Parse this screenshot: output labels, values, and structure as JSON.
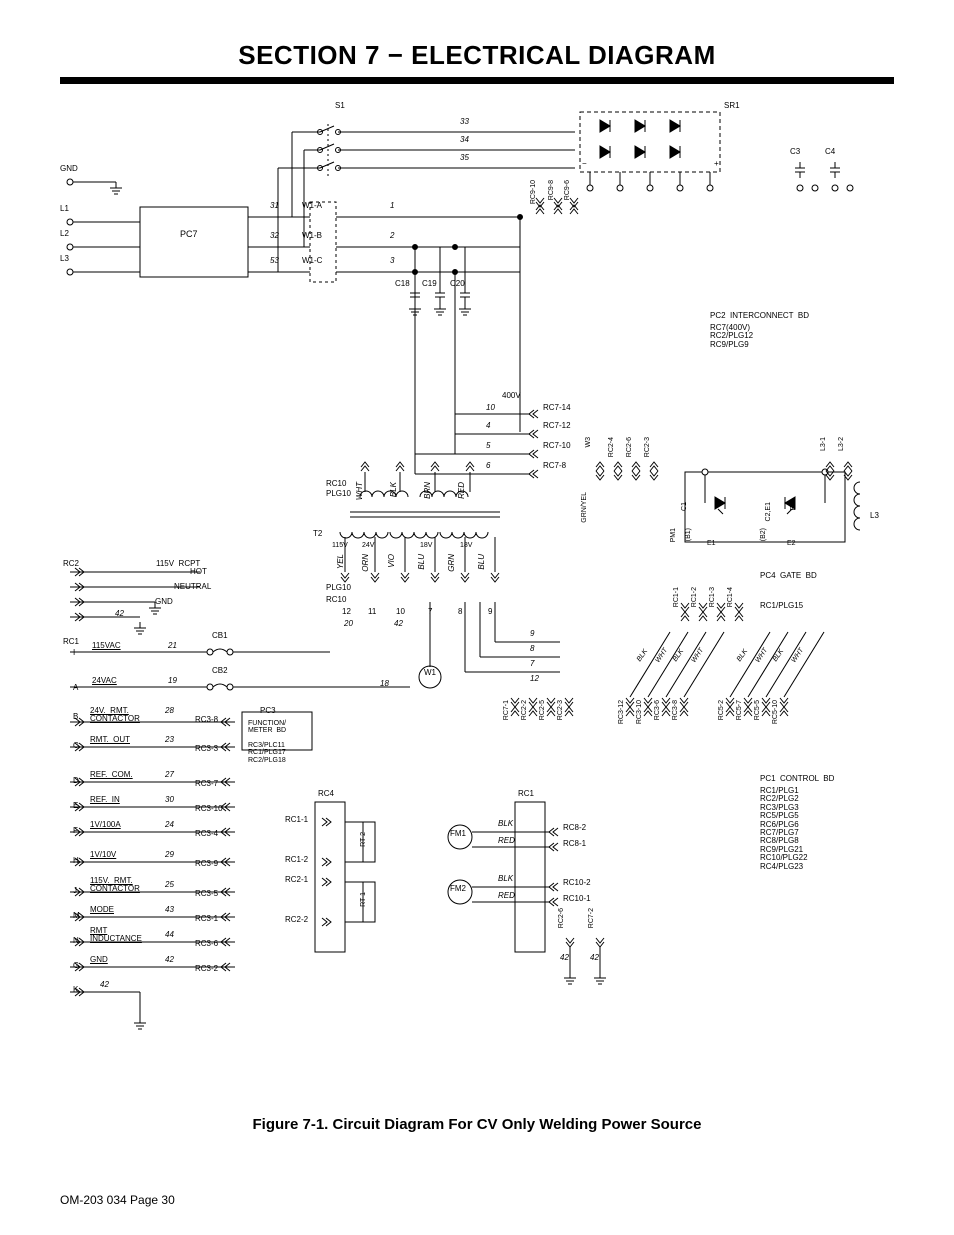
{
  "title": "SECTION 7 − ELECTRICAL DIAGRAM",
  "caption": "Figure 7-1. Circuit Diagram For CV Only Welding Power Source",
  "footer": "OM-203 034 Page 30",
  "blocks": {
    "pc7": "PC7",
    "pc3": "PC3",
    "pc3_sub": "FUNCTION/\nMETER  BD",
    "pc4": "PC4  GATE  BD",
    "pc2": "PC2  INTERCONNECT  BD",
    "pc2_sub": "RC7(400V)\nRC2/PLG12\nRC9/PLG9",
    "pc1": "PC1  CONTROL  BD",
    "pc1_sub": "RC1/PLG1\nRC2/PLG2\nRC3/PLG3\nRC5/PLG5\nRC6/PLG6\nRC7/PLG7\nRC8/PLG8\nRC9/PLG21\nRC10/PLG22\nRC4/PLG23"
  },
  "components": {
    "s1": "S1",
    "sr1": "SR1",
    "c3": "C3",
    "c4": "C4",
    "c18": "C18",
    "c19": "C19",
    "c20": "C20",
    "t2": "T2",
    "cb1": "CB1",
    "cb2": "CB2",
    "w1": "W1",
    "fm1": "FM1",
    "fm2": "FM2",
    "rt1": "RT 1",
    "rt2": "RT 2",
    "l3": "L3",
    "pm1": "PM1",
    "b1": "(B1)",
    "b2": "(B2)",
    "c1": "C1",
    "c2e1": "C2,E1",
    "e1": "E1",
    "e2": "E2",
    "e2b": "E2",
    "w3": "W3"
  },
  "mains": {
    "gnd": "GND",
    "l1": "L1",
    "l2": "L2",
    "l3": "L3"
  },
  "w1_taps": {
    "a": "W1-A",
    "b": "W1-B",
    "c": "W1-C"
  },
  "wire_n": {
    "n31": "31",
    "n32": "32",
    "n53": "53",
    "n33": "33",
    "n34": "34",
    "n35": "35",
    "n1": "1",
    "n2": "2",
    "n3": "3",
    "n400v": "400V",
    "n10": "10",
    "n4": "4",
    "n5": "5",
    "n6": "6"
  },
  "rc7": {
    "p14": "RC7-14",
    "p12": "RC7-12",
    "p10": "RC7-10",
    "p8": "RC7-8"
  },
  "rc9": {
    "p10": "RC9-10",
    "p8": "RC9-8",
    "p6": "RC9-6"
  },
  "rc2_top": {
    "p4": "RC2-4",
    "p6": "RC2-6",
    "p3": "RC2-3"
  },
  "l3_top": {
    "p1": "L3-1",
    "p2": "L3-2"
  },
  "transformer": {
    "rc10": "RC10",
    "plg10": "PLG10",
    "plg10b": "PLG10",
    "rc10b": "RC10",
    "v1": "115V",
    "v2": "24V",
    "v3": "18V",
    "v4": "18V",
    "wht": "WHT",
    "blk": "BLK",
    "brn": "BRN",
    "red": "RED",
    "yel": "YEL",
    "orn": "ORN",
    "vio": "VIO",
    "blu": "BLU",
    "grn": "GRN",
    "blu2": "BLU",
    "pins": {
      "p12": "12",
      "p11": "11",
      "p10": "10",
      "p7": "7",
      "p8": "8",
      "p9": "9"
    },
    "trace": {
      "n20": "20",
      "n42": "42",
      "n18": "18",
      "n9": "9",
      "n8": "8",
      "n7": "7",
      "n12": "12"
    }
  },
  "rcpt": {
    "title": "115V  RCPT",
    "hot": "HOT",
    "neutral": "NEUTRAL",
    "gnd": "GND",
    "n42": "42"
  },
  "rc2_left": "RC2",
  "rc1_left": "RC1",
  "cb_labels": {
    "v115": "115VAC",
    "v24": "24VAC",
    "n21": "21",
    "n19": "19"
  },
  "rc3": {
    "sub": "RC3/PLC11\nRC1/PLG17\nRC2/PLG18",
    "p8": "RC3-8",
    "p3": "RC3-3",
    "p7": "RC3-7",
    "p10": "RC3-10",
    "p4": "RC3-4",
    "p9": "RC3-9",
    "p5": "RC3-5",
    "p1": "RC3-1",
    "p6": "RC3-6",
    "p2": "RC3-2"
  },
  "left_io": {
    "I": "I",
    "A": "A",
    "B": "B",
    "C": "C",
    "D": "D",
    "E": "E",
    "F": "F",
    "H": "H",
    "J": "J",
    "M": "M",
    "N": "N",
    "G": "G",
    "K": "K",
    "B_lbl": "24V.  RMT.\nCONTACTOR",
    "C_lbl": "RMT.  OUT",
    "D_lbl": "REF.  COM.",
    "E_lbl": "REF.  IN",
    "F_lbl": "1V/100A",
    "H_lbl": "1V/10V",
    "J_lbl": "115V.  RMT.\nCONTACTOR",
    "M_lbl": "MODE",
    "N_lbl": "RMT\nINDUCTANCE",
    "G_lbl": "GND",
    "n28": "28",
    "n23": "23",
    "n27": "27",
    "n30": "30",
    "n24": "24",
    "n29": "29",
    "n25": "25",
    "n43": "43",
    "n44": "44",
    "n42": "42",
    "n42b": "42"
  },
  "rc4": "RC4",
  "rc1_blk": "RC1",
  "rc1": {
    "p1": "RC1-1",
    "p2": "RC1-2"
  },
  "rc2": {
    "p1": "RC2-1",
    "p2": "RC2-2"
  },
  "fm_colors": {
    "blk": "BLK",
    "red": "RED"
  },
  "rc8": {
    "p2": "RC8-2",
    "p1": "RC8-1"
  },
  "rc10_right": {
    "p2": "RC10-2",
    "p1": "RC10-1"
  },
  "rc_bottom": {
    "rc7_1": "RC7-1",
    "rc2_2": "RC2-2",
    "rc2_5": "RC2-5",
    "rc2_3": "RC2-3",
    "rc3_12": "RC3-12",
    "rc3_10": "RC3-10",
    "rc3_6": "RC3-6",
    "rc3_8": "RC3-8",
    "rc5_2": "RC5-2",
    "rc5_7": "RC5-7",
    "rc5_5": "RC5-5",
    "rc5_10": "RC5-10",
    "rc2_6": "RC2-6",
    "rc7_2": "RC7-2"
  },
  "rc1_plg15": "RC1/PLG15",
  "rc_top_right": {
    "rc1_1": "RC1-1",
    "rc1_2": "RC1-2",
    "rc1_3": "RC1-3",
    "rc1_4": "RC1-4"
  },
  "gnd42": {
    "a": "42",
    "b": "42"
  },
  "grn_yel": "GRN/YEL",
  "col_rt": {
    "blk": "BLK",
    "wht": "WHT"
  },
  "pol": {
    "minus": "−",
    "plus": "+"
  }
}
